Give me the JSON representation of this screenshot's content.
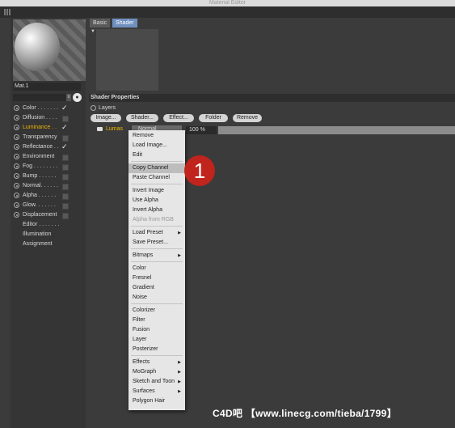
{
  "window": {
    "title": "Material Editor"
  },
  "material": {
    "name": "Mat.1"
  },
  "filter": {
    "clear_label": "x"
  },
  "channels": [
    {
      "label": "Color . . . . . . .",
      "state": "checked",
      "active": false
    },
    {
      "label": "Diffusion . . . .",
      "state": "unchecked",
      "active": false
    },
    {
      "label": "Luminance . .",
      "state": "checked",
      "active": true
    },
    {
      "label": "Transparency",
      "state": "unchecked",
      "active": false
    },
    {
      "label": "Reflectance . .",
      "state": "checked",
      "active": false
    },
    {
      "label": "Environment",
      "state": "unchecked",
      "active": false
    },
    {
      "label": "Fog . . . . . . . .",
      "state": "unchecked",
      "active": false
    },
    {
      "label": "Bump . . . . . .",
      "state": "unchecked",
      "active": false
    },
    {
      "label": "Normal. . . . . .",
      "state": "unchecked",
      "active": false
    },
    {
      "label": "Alpha . . . . . .",
      "state": "unchecked",
      "active": false
    },
    {
      "label": "Glow. . . . . . .",
      "state": "unchecked",
      "active": false
    },
    {
      "label": "Displacement",
      "state": "unchecked",
      "active": false
    }
  ],
  "sub_items": [
    "Editor . . . . . . .",
    "Illumination",
    "Assignment"
  ],
  "tabs": [
    "Basic",
    "Shader"
  ],
  "shader_properties": {
    "section_title": "Shader Properties",
    "layers_label": "Layers",
    "buttons": [
      "Image...",
      "Shader...",
      "Effect...",
      "Folder",
      "Remove"
    ],
    "layer": {
      "name": "Lumas",
      "blend_mode": "Normal",
      "opacity": "100 %"
    }
  },
  "context_menu": [
    {
      "label": "Remove"
    },
    {
      "label": "Load Image..."
    },
    {
      "label": "Edit"
    },
    {
      "sep": true
    },
    {
      "label": "Copy Channel",
      "highlight": true
    },
    {
      "label": "Paste Channel"
    },
    {
      "sep": true
    },
    {
      "label": "Invert Image"
    },
    {
      "label": "Use Alpha"
    },
    {
      "label": "Invert Alpha"
    },
    {
      "label": "Alpha from RGB",
      "disabled": true
    },
    {
      "sep": true
    },
    {
      "label": "Load Preset",
      "submenu": true
    },
    {
      "label": "Save Preset..."
    },
    {
      "sep": true
    },
    {
      "label": "Bitmaps",
      "submenu": true
    },
    {
      "sep": true
    },
    {
      "label": "Color"
    },
    {
      "label": "Fresnel"
    },
    {
      "label": "Gradient"
    },
    {
      "label": "Noise"
    },
    {
      "sep": true
    },
    {
      "label": "Colorizer"
    },
    {
      "label": "Filter"
    },
    {
      "label": "Fusion"
    },
    {
      "label": "Layer"
    },
    {
      "label": "Posterizer"
    },
    {
      "sep": true
    },
    {
      "label": "Effects",
      "submenu": true
    },
    {
      "label": "MoGraph",
      "submenu": true
    },
    {
      "label": "Sketch and Toon",
      "submenu": true
    },
    {
      "label": "Surfaces",
      "submenu": true
    },
    {
      "label": "Polygon Hair"
    }
  ],
  "annotation": {
    "number": "1",
    "color": "#c0241c"
  },
  "watermark": "C4D吧 【www.linecg.com/tieba/1799】",
  "colors": {
    "active_channel": "#f2b400",
    "selected_tab": "#6f8fbf"
  }
}
